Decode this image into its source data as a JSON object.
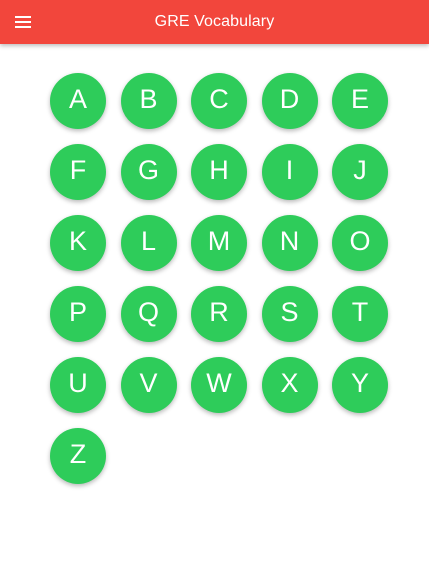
{
  "app_bar": {
    "title": "GRE Vocabulary",
    "menu_icon": "hamburger-menu-icon",
    "background_color": "#f2463c",
    "text_color": "#ffffff"
  },
  "letters": {
    "button_color": "#2ecc5a",
    "items": [
      "A",
      "B",
      "C",
      "D",
      "E",
      "F",
      "G",
      "H",
      "I",
      "J",
      "K",
      "L",
      "M",
      "N",
      "O",
      "P",
      "Q",
      "R",
      "S",
      "T",
      "U",
      "V",
      "W",
      "X",
      "Y",
      "Z"
    ]
  }
}
